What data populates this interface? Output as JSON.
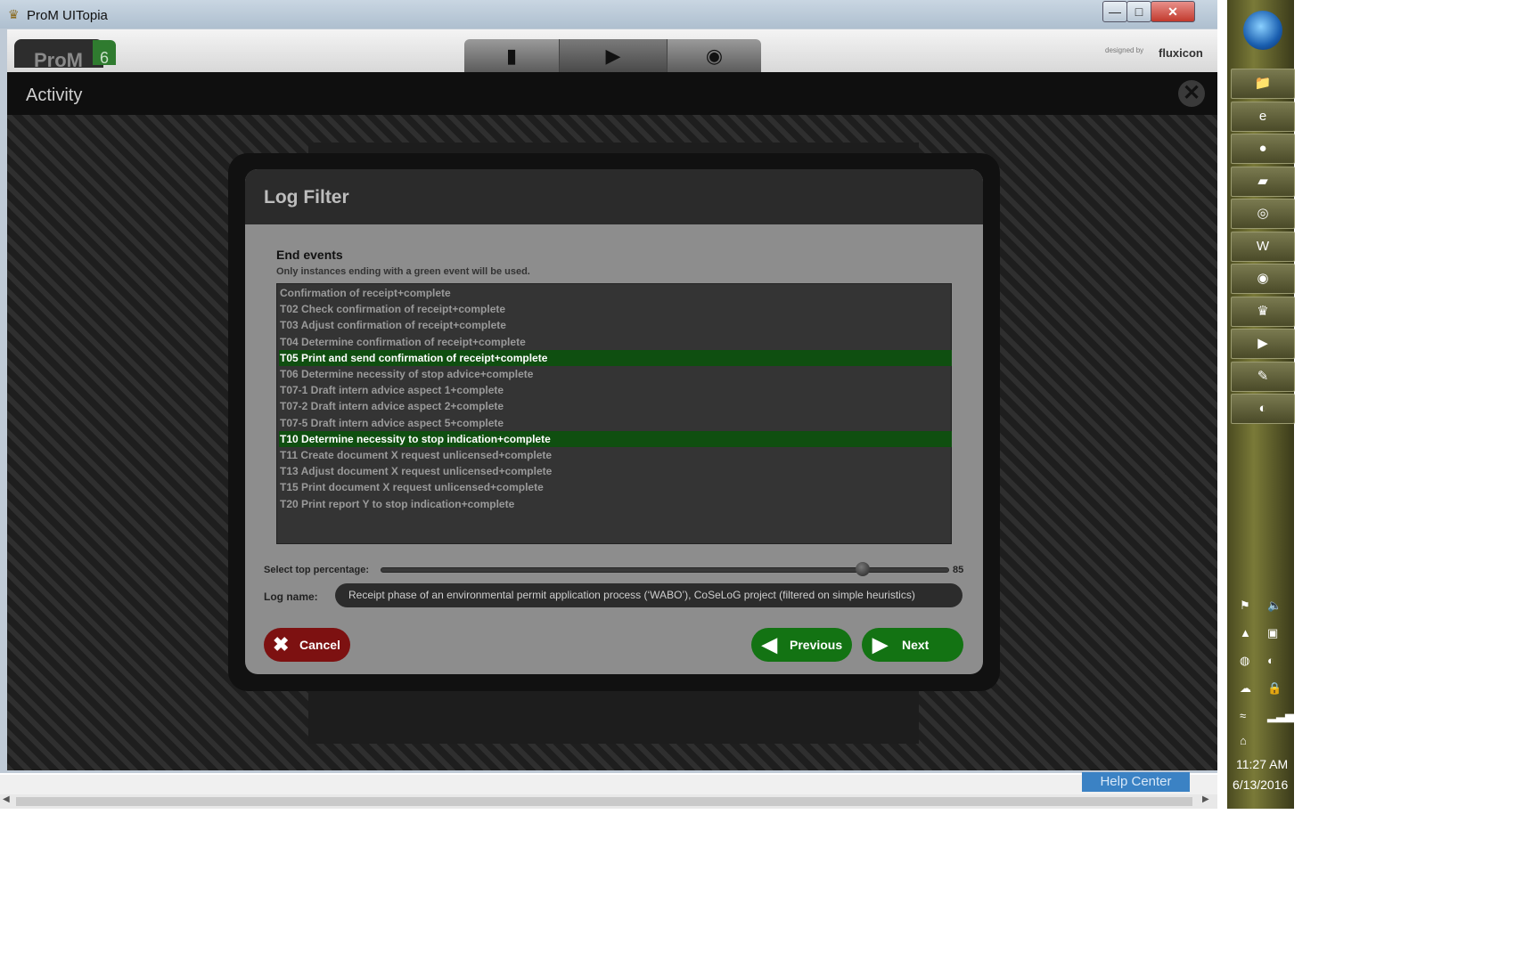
{
  "window": {
    "title": "ProM UITopia",
    "minimize": "—",
    "maximize": "□",
    "close": "✕"
  },
  "prom": {
    "logo": "ProM",
    "logo_version": "6",
    "designed_by": "designed by",
    "brand": "fluxicon",
    "tabs": [
      {
        "name": "workspace",
        "icon": "▮"
      },
      {
        "name": "actions",
        "icon": "▶"
      },
      {
        "name": "views",
        "icon": "◉"
      }
    ]
  },
  "activity": {
    "title": "Activity",
    "close": "✕"
  },
  "dialog": {
    "title": "Log Filter",
    "section_title": "End events",
    "section_subtitle": "Only instances ending with a green event will be used.",
    "events": [
      {
        "label": "Confirmation of receipt+complete",
        "selected": false
      },
      {
        "label": "T02 Check confirmation of receipt+complete",
        "selected": false
      },
      {
        "label": "T03 Adjust confirmation of receipt+complete",
        "selected": false
      },
      {
        "label": "T04 Determine confirmation of receipt+complete",
        "selected": false
      },
      {
        "label": "T05 Print and send confirmation of receipt+complete",
        "selected": true
      },
      {
        "label": "T06 Determine necessity of stop advice+complete",
        "selected": false
      },
      {
        "label": "T07-1 Draft intern advice aspect 1+complete",
        "selected": false
      },
      {
        "label": "T07-2 Draft intern advice aspect 2+complete",
        "selected": false
      },
      {
        "label": "T07-5 Draft intern advice aspect 5+complete",
        "selected": false
      },
      {
        "label": "T10 Determine necessity to stop indication+complete",
        "selected": true
      },
      {
        "label": "T11 Create document X request unlicensed+complete",
        "selected": false
      },
      {
        "label": "T13 Adjust document X request unlicensed+complete",
        "selected": false
      },
      {
        "label": "T15 Print document X request unlicensed+complete",
        "selected": false
      },
      {
        "label": "T20 Print report Y to stop indication+complete",
        "selected": false
      }
    ],
    "slider_label": "Select top percentage:",
    "slider_value": "85",
    "slider_level": 0.85,
    "log_name_label": "Log name:",
    "log_name_value": "Receipt phase of an environmental permit application process (‘WABO’), CoSeLoG project (filtered on simple heuristics)",
    "cancel_label": "Cancel",
    "previous_label": "Previous",
    "next_label": "Next"
  },
  "background": {
    "help_center": "Help Center"
  },
  "taskbar": {
    "items": [
      {
        "name": "explorer",
        "icon": "📁"
      },
      {
        "name": "internet-explorer",
        "icon": "e"
      },
      {
        "name": "firefox",
        "icon": "●"
      },
      {
        "name": "folder",
        "icon": "▰"
      },
      {
        "name": "chrome",
        "icon": "◎"
      },
      {
        "name": "word",
        "icon": "W"
      },
      {
        "name": "app-purple",
        "icon": "◉"
      },
      {
        "name": "prom",
        "icon": "♛"
      },
      {
        "name": "media",
        "icon": "▶"
      },
      {
        "name": "paint",
        "icon": "✎"
      },
      {
        "name": "app-blue",
        "icon": "◐"
      }
    ],
    "time": "11:27 AM",
    "date": "6/13/2016"
  },
  "colors": {
    "selected_event": "#0f4f10",
    "cancel": "#7d1111",
    "nav_button": "#137313"
  }
}
